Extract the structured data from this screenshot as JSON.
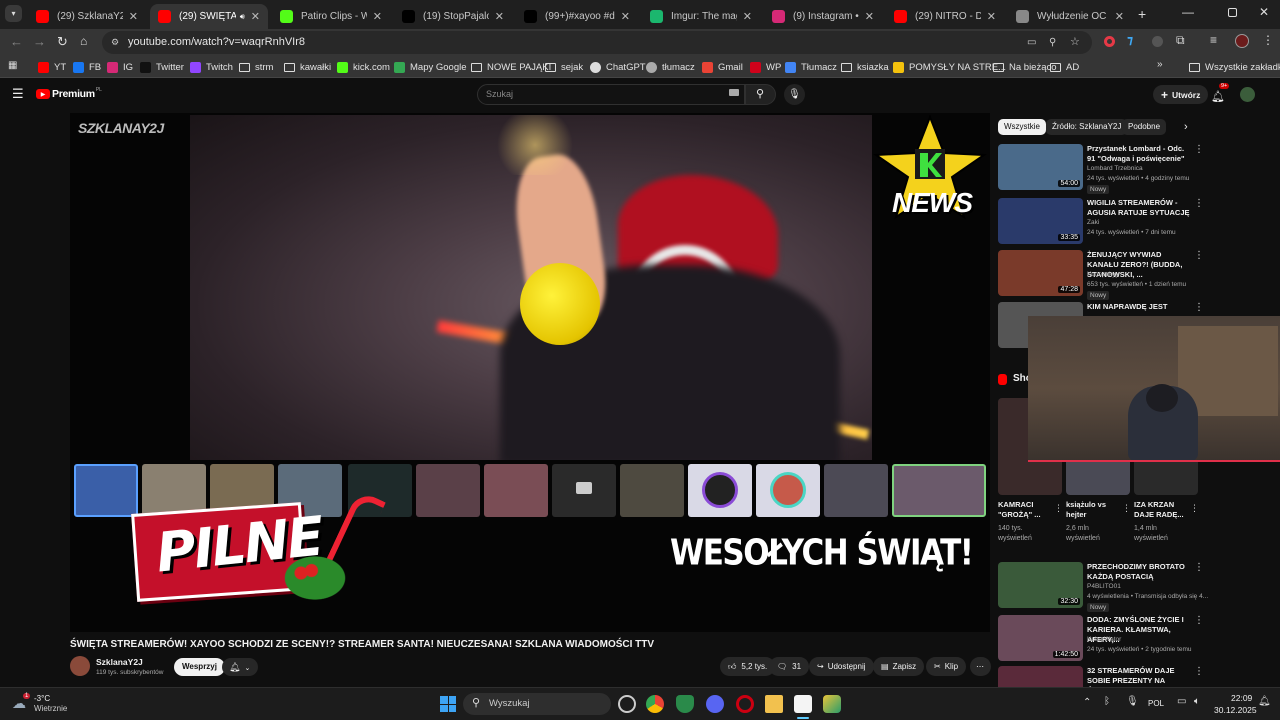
{
  "browser": {
    "tabs": [
      {
        "title": "(29) SzklanaY2J - You",
        "fav": "#ff0000",
        "active": false
      },
      {
        "title": "(29) ŚWIĘTA STRE",
        "fav": "#ff0000",
        "active": true
      },
      {
        "title": "Patiro Clips - Watch I",
        "fav": "#53fc18",
        "active": false
      },
      {
        "title": "(19) StopPajalock w s",
        "fav": "#000000",
        "active": false
      },
      {
        "title": "(99+)#xayoo #dc #di",
        "fav": "#000000",
        "active": false
      },
      {
        "title": "Imgur: The magic of",
        "fav": "#1bb76e",
        "active": false
      },
      {
        "title": "(9) Instagram • Mess",
        "fav": "#d62976",
        "active": false
      },
      {
        "title": "(29) NITRO - DISS NA",
        "fav": "#ff0000",
        "active": false
      },
      {
        "title": "Wyłudzenie OC w Po",
        "fav": "#888888",
        "active": false
      }
    ],
    "url": "youtube.com/watch?v=waqrRnhVIr8",
    "bookmarks": [
      {
        "label": "YT",
        "kind": "yt"
      },
      {
        "label": "FB",
        "kind": "fb"
      },
      {
        "label": "IG",
        "kind": "ig"
      },
      {
        "label": "Twitter",
        "kind": "x"
      },
      {
        "label": "Twitch",
        "kind": "twitch"
      },
      {
        "label": "strm",
        "kind": "folder"
      },
      {
        "label": "kawałki",
        "kind": "folder"
      },
      {
        "label": "kick.com",
        "kind": "kick"
      },
      {
        "label": "Mapy Google",
        "kind": "maps"
      },
      {
        "label": "NOWE PAJĄKI",
        "kind": "folder"
      },
      {
        "label": "sejak",
        "kind": "folder"
      },
      {
        "label": "ChatGPT",
        "kind": "gpt"
      },
      {
        "label": "tłumacz",
        "kind": "globe"
      },
      {
        "label": "Gmail",
        "kind": "gmail"
      },
      {
        "label": "WP",
        "kind": "wp"
      },
      {
        "label": "Tłumacz",
        "kind": "translate"
      },
      {
        "label": "ksiazka",
        "kind": "folder"
      },
      {
        "label": "POMYSŁY NA STRE...",
        "kind": "yellow"
      },
      {
        "label": "Na bieżąco",
        "kind": "folder"
      },
      {
        "label": "AD",
        "kind": "folder"
      }
    ],
    "all_bookmarks": "Wszystkie zakładki"
  },
  "youtube": {
    "logo": "Premium",
    "logo_sup": "PL",
    "search_placeholder": "Szukaj",
    "create_label": "Utwórz",
    "notif_count": "9+",
    "player": {
      "channel_watermark": "SZKLANAY2J",
      "banner_left": "PILNE",
      "banner_right": "WESOŁYCH ŚWIĄT!",
      "news_logo": "NEWS"
    },
    "video_title": "ŚWIĘTA STREAMERÓW! XAYOO SCHODZI ZE SCENY!? STREAMER SANTA! NIEUCZESANA! SZKLANA WIADOMOŚCI TTV",
    "channel": {
      "name": "SzklanaY2J",
      "subs": "119 tys. subskrybentów",
      "join_label": "Wesprzyj"
    },
    "actions": {
      "likes": "5,2 tys.",
      "comments": "31",
      "share": "Udostępnij",
      "save": "Zapisz",
      "clip": "Klip"
    },
    "chips": [
      "Wszystkie",
      "Źródło: SzklanaY2J",
      "Podobne"
    ],
    "recommendations": [
      {
        "title": "Przystanek Lombard - Odc. 91 \"Odwaga i poświęcenie\"",
        "channel": "Lombard Trzebnica",
        "meta": "24 tys. wyświetleń • 4 godziny temu",
        "duration": "54:00",
        "new": "Nowy"
      },
      {
        "title": "WIGILIA STREAMERÓW - AGUSIA RATUJE SYTUACJĘ",
        "channel": "Zaki",
        "meta": "24 tys. wyświetleń • 7 dni temu",
        "duration": "33:35",
        "new": ""
      },
      {
        "title": "ŻENUJĄCY WYWIAD KANAŁU ZERO?! (BUDDA, STANOWSKI, ...",
        "channel": "Konopskyy",
        "meta": "653 tys. wyświetleń • 1 dzień temu",
        "duration": "47:28",
        "new": "Nowy"
      },
      {
        "title": "KIM NAPRAWDĘ JEST",
        "channel": "",
        "meta": "",
        "duration": "",
        "new": ""
      }
    ],
    "shorts_label": "Sho",
    "shorts": [
      {
        "title": "KAMRACI \"GROŻĄ\" ...",
        "views": "140 tys. wyświetleń"
      },
      {
        "title": "książulo vs hejter",
        "views": "2,6 mln wyświetleń"
      },
      {
        "title": "IZA KRZAN DAJE RADĘ...",
        "views": "1,4 mln wyświetleń"
      }
    ],
    "recommendations2": [
      {
        "title": "PRZECHODZIMY BROTATO KAŻDĄ POSTACIĄ",
        "channel": "P4BLITO01",
        "meta": "4 wyświetlenia • Transmisja odbyła się 4...",
        "duration": "32:30",
        "new": "Nowy"
      },
      {
        "title": "DODA: ZMYŚLONE ŻYCIE I KARIERA. KŁAMSTWA, AFERY,...",
        "channel": "Kuba Wątor",
        "meta": "24 tys. wyświetleń • 2 tygodnie temu",
        "duration": "1:42:50",
        "new": ""
      },
      {
        "title": "32 STREAMERÓW DAJE SOBIE PREZENTY NA ŚWIĘTA!",
        "channel": "",
        "meta": "",
        "duration": "",
        "new": ""
      }
    ]
  },
  "taskbar": {
    "weather_temp": "-3°C",
    "weather_desc": "Wietrznie",
    "weather_badge": "1",
    "search_label": "Wyszukaj",
    "lang": "POL",
    "time": "22:09",
    "date": "30.12.2025"
  }
}
